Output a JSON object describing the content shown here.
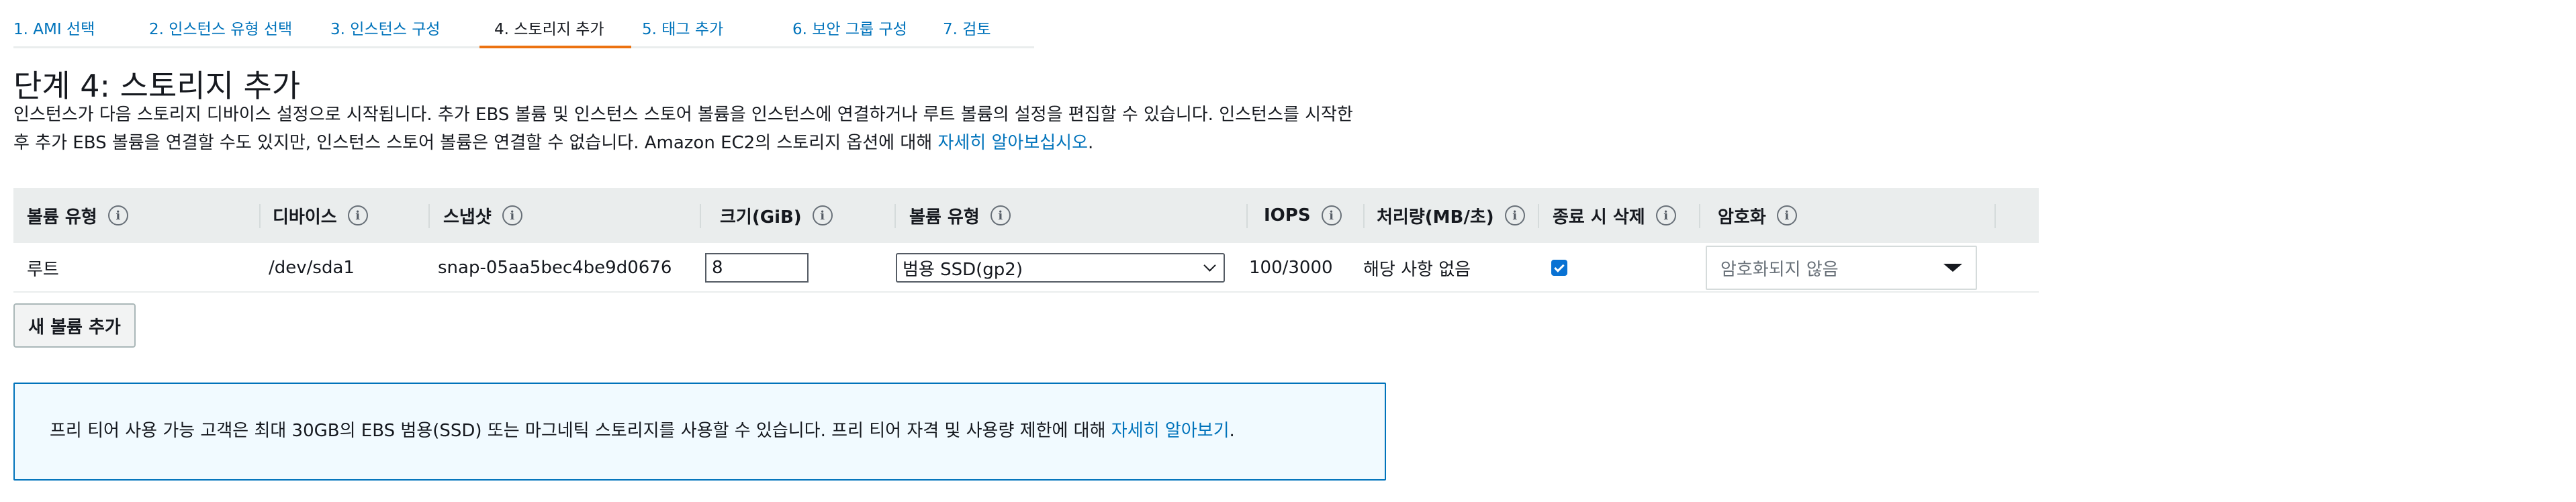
{
  "wizard": {
    "tabs": [
      {
        "label": "1. AMI 선택",
        "active": false
      },
      {
        "label": "2. 인스턴스 유형 선택",
        "active": false
      },
      {
        "label": "3. 인스턴스 구성",
        "active": false
      },
      {
        "label": "4. 스토리지 추가",
        "active": true
      },
      {
        "label": "5. 태그 추가",
        "active": false
      },
      {
        "label": "6. 보안 그룹 구성",
        "active": false
      },
      {
        "label": "7. 검토",
        "active": false
      }
    ]
  },
  "page": {
    "title": "단계 4: 스토리지 추가",
    "description_line1": "인스턴스가 다음 스토리지 디바이스 설정으로 시작됩니다. 추가 EBS 볼륨 및 인스턴스 스토어 볼륨을 인스턴스에 연결하거나 루트 볼륨의 설정을 편집할 수 있습니다. 인스턴스를 시작한",
    "description_line2": "후 추가 EBS 볼륨을 연결할 수도 있지만, 인스턴스 스토어 볼륨은 연결할 수 없습니다. Amazon EC2의 스토리지 옵션에 대해 ",
    "learn_more_link": "자세히 알아보십시오",
    "description_end": "."
  },
  "table": {
    "columns": {
      "volume_type": "볼륨 유형",
      "device": "디바이스",
      "snapshot": "스냅샷",
      "size": "크기(GiB)",
      "volume_kind": "볼륨 유형",
      "iops": "IOPS",
      "throughput": "처리량(MB/초)",
      "delete_on_termination": "종료 시 삭제",
      "encryption": "암호화"
    },
    "info_glyph": "i",
    "row": {
      "volume_type": "루트",
      "device": "/dev/sda1",
      "snapshot": "snap-05aa5bec4be9d0676",
      "size": "8",
      "volume_kind": "범용 SSD(gp2)",
      "iops": "100/3000",
      "throughput": "해당 사항 없음",
      "delete_on_termination": true,
      "encryption": "암호화되지 않음"
    }
  },
  "actions": {
    "add_volume": "새 볼륨 추가"
  },
  "alert": {
    "text": "프리 티어 사용 가능 고객은 최대 30GB의 EBS 범용(SSD) 또는 마그네틱 스토리지를 사용할 수 있습니다. 프리 티어 자격 및 사용량 제한에 대해 ",
    "link": "자세히 알아보기",
    "end": "."
  },
  "colors": {
    "accent": "#ec7211",
    "link": "#0073bb",
    "header_bg": "#eaeded",
    "alert_bg": "#f1faff"
  }
}
